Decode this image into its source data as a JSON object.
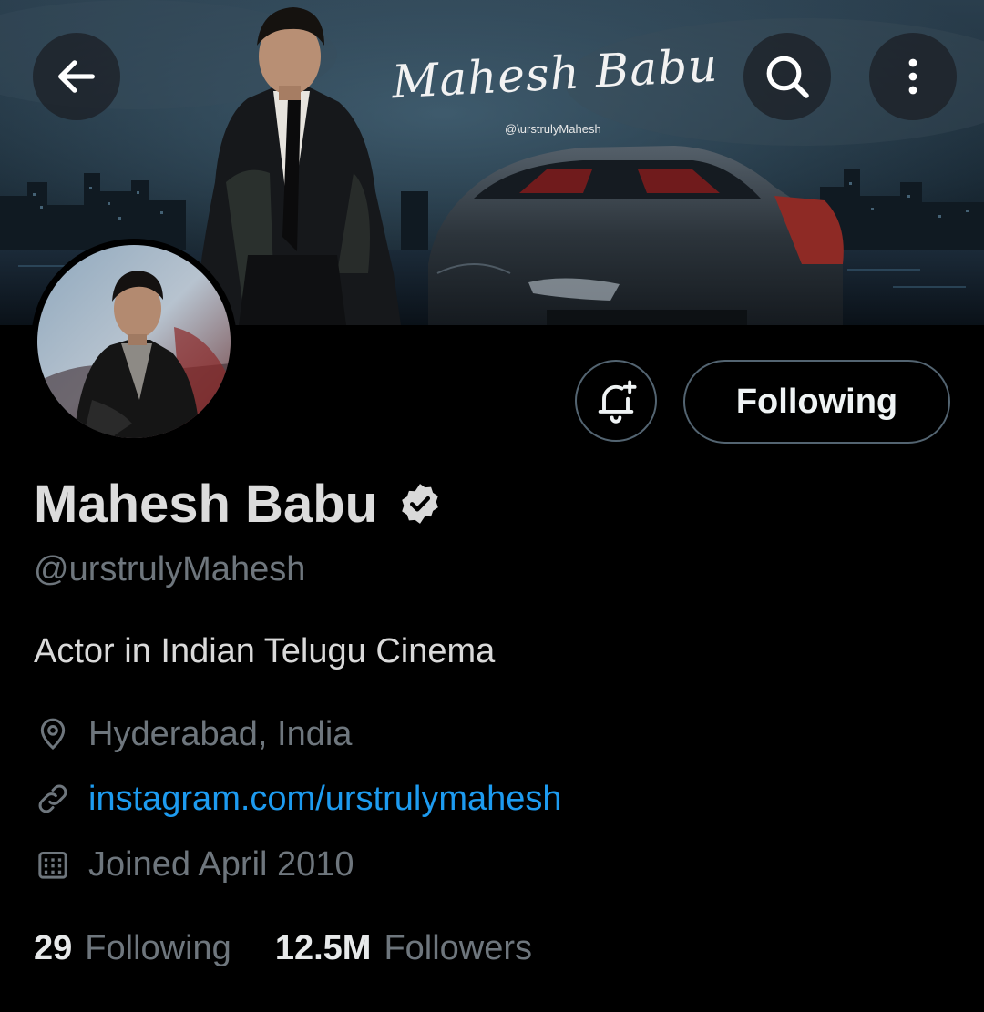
{
  "banner": {
    "script_title": "Mahesh Babu",
    "social_handle": "@\\urstrulyMahesh"
  },
  "header": {
    "back_icon": "arrow-left-icon",
    "search_icon": "search-icon",
    "more_icon": "more-vertical-icon"
  },
  "profile": {
    "display_name": "Mahesh Babu",
    "verified": true,
    "handle": "@urstrulyMahesh",
    "bio": "Actor in Indian Telugu Cinema",
    "location": "Hyderabad, India",
    "website": "instagram.com/urstrulymahesh",
    "joined": "Joined April 2010"
  },
  "actions": {
    "notify_icon": "bell-plus-icon",
    "follow_label": "Following"
  },
  "stats": {
    "following_count": "29",
    "following_label": "Following",
    "followers_count": "12.5M",
    "followers_label": "Followers"
  },
  "colors": {
    "background": "#000000",
    "link": "#1d9bf0",
    "secondary_text": "#6e767d",
    "border": "#536471"
  }
}
